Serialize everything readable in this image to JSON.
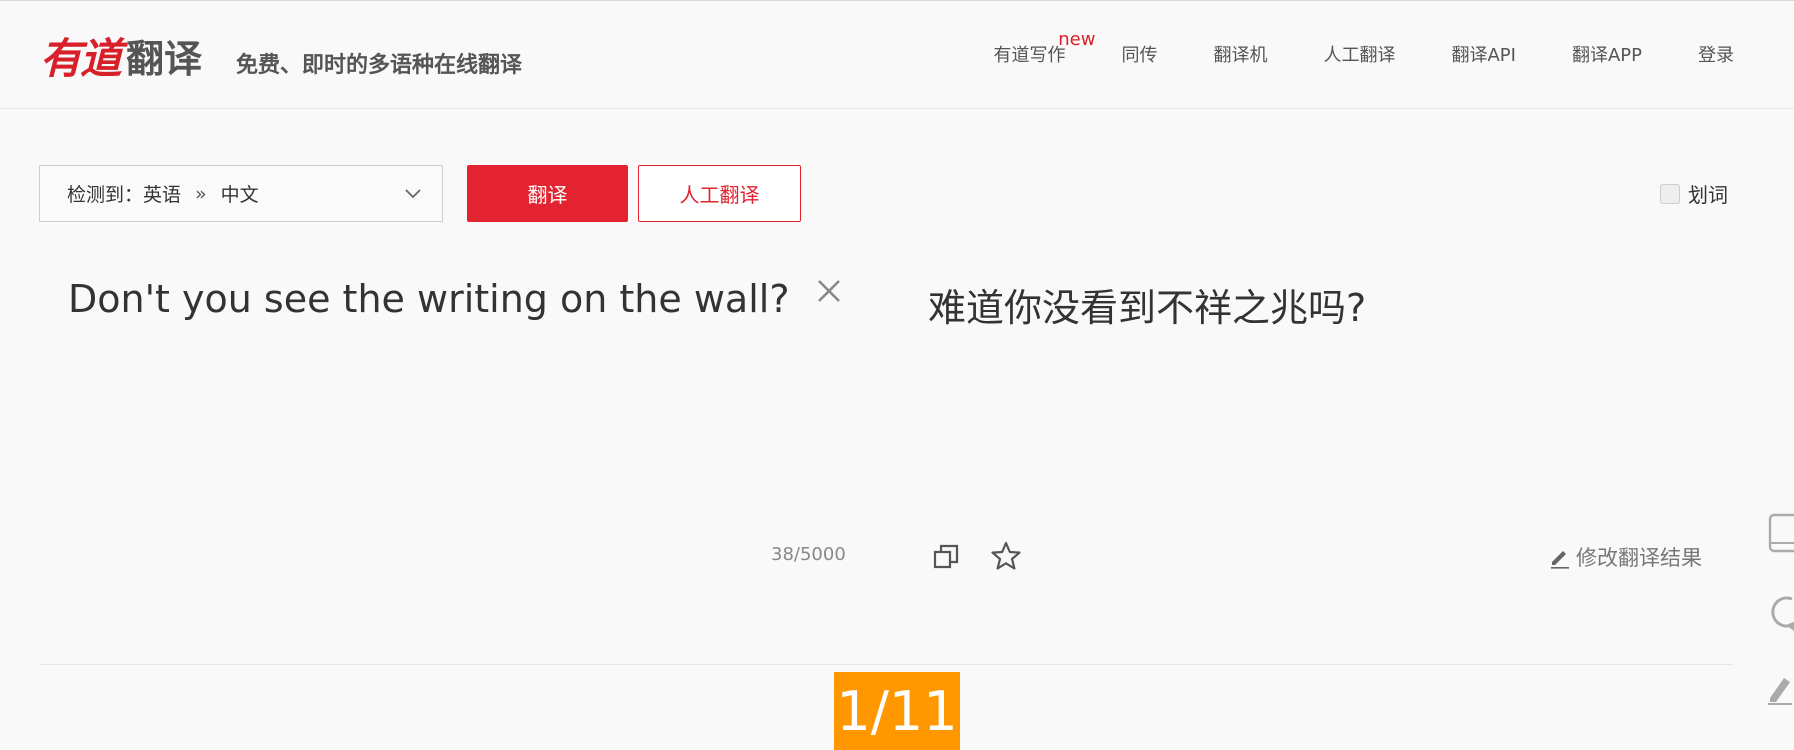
{
  "header": {
    "logo_mark": "有道",
    "logo_word": "翻译",
    "slogan": "免费、即时的多语种在线翻译",
    "nav": [
      {
        "label": "有道写作",
        "badge": "new"
      },
      {
        "label": "同传"
      },
      {
        "label": "翻译机"
      },
      {
        "label": "人工翻译"
      },
      {
        "label": "翻译API"
      },
      {
        "label": "翻译APP"
      },
      {
        "label": "登录"
      }
    ]
  },
  "toolbar": {
    "lang_detected": "检测到：英语",
    "lang_sep": "»",
    "lang_target": "中文",
    "translate_label": "翻译",
    "human_translate_label": "人工翻译",
    "huaci_label": "划词"
  },
  "source": {
    "text": "Don't you see the writing on the wall?",
    "char_count": "38/5000"
  },
  "target": {
    "text": "难道你没看到不祥之兆吗?",
    "edit_label": "修改翻译结果"
  },
  "pager": {
    "label": "1/11"
  },
  "colors": {
    "brand_red": "#e3232f",
    "badge_orange": "#ff9800"
  },
  "icons": [
    "chevron-down-icon",
    "close-icon",
    "copy-icon",
    "star-icon",
    "pencil-icon",
    "tablet-icon",
    "refresh-icon",
    "edit-icon"
  ]
}
